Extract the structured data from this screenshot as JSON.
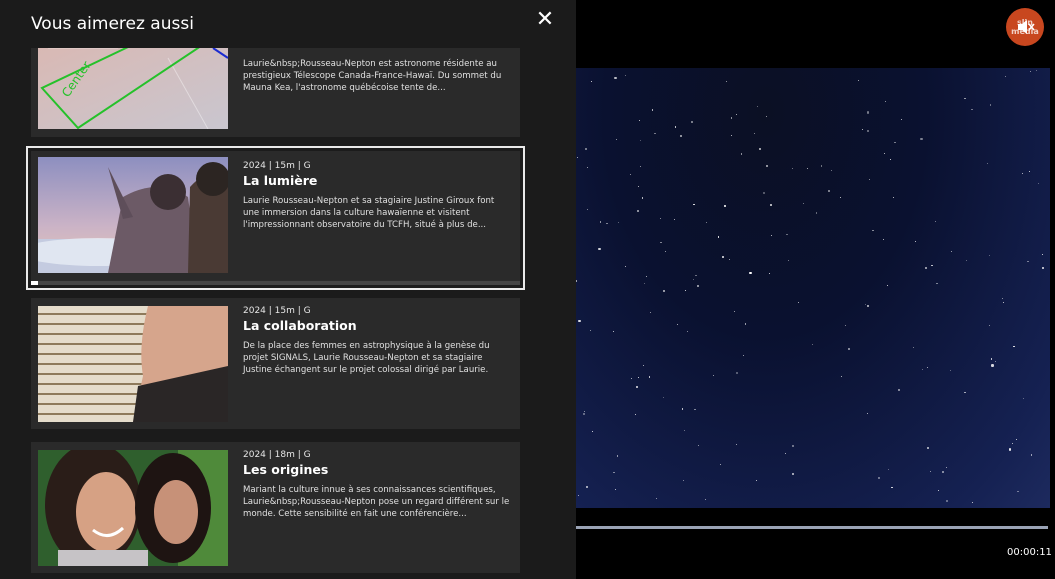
{
  "panel": {
    "title": "Vous aimerez aussi",
    "close_icon": "close-icon"
  },
  "cards": [
    {
      "meta": "",
      "title": "",
      "description": "Laurie&nbsp;Rousseau-Nepton est astronome résidente au prestigieux Télescope Canada-France-Hawaï. Du sommet du Mauna Kea, l'astronome québécoise tente de...",
      "thumb_label": "Center"
    },
    {
      "meta": "2024 | 15m | G",
      "title": "La lumière",
      "description": "Laurie Rousseau-Nepton et sa stagiaire Justine Giroux font une immersion dans la culture hawaïenne et visitent l'impressionnant observatoire du TCFH, situé à plus de...",
      "progress": 0.015
    },
    {
      "meta": "2024 | 15m | G",
      "title": "La collaboration",
      "description": "De la place des femmes en astrophysique à la genèse du projet SIGNALS, Laurie Rousseau-Nepton et sa stagiaire Justine échangent sur le projet colossal dirigé par Laurie."
    },
    {
      "meta": "2024 | 18m | G",
      "title": "Les origines",
      "description": "Mariant la culture innue à ses connaissances scientifiques, Laurie&nbsp;Rousseau-Nepton pose un regard différent sur le monde. Cette sensibilité en fait une conférencière..."
    }
  ],
  "player": {
    "time": "00:00:11",
    "progress": 1.0,
    "mute_icon": "speaker-muted-icon",
    "brand_text": "slin media"
  },
  "colors": {
    "panel_bg": "#1b1b1b",
    "card_bg": "#2a2a2a",
    "mute_button": "#c8471f"
  }
}
